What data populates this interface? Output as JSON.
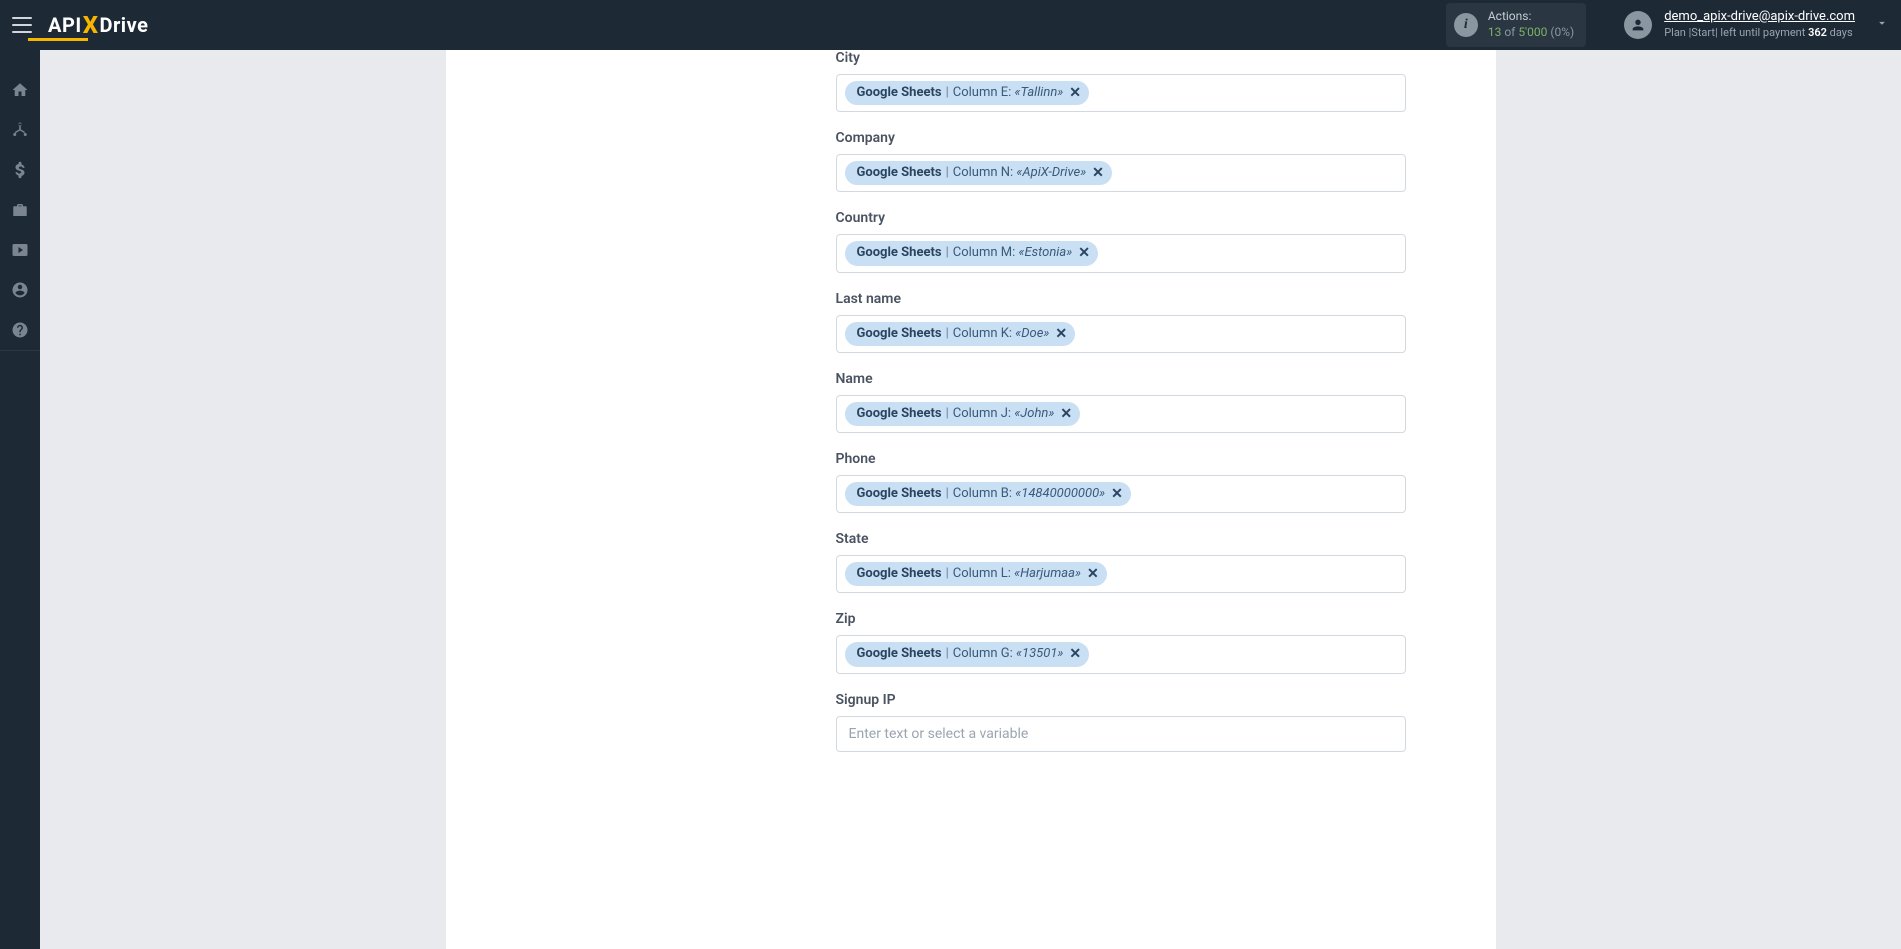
{
  "header": {
    "logo_prefix": "API",
    "logo_x": "X",
    "logo_suffix": "Drive",
    "actions_label": "Actions:",
    "actions_used": "13",
    "actions_of": "of",
    "actions_limit": "5'000",
    "actions_pct": "(0%)",
    "user_email": "demo_apix-drive@apix-drive.com",
    "plan_prefix": "Plan |",
    "plan_name": "Start",
    "plan_mid": "| left until payment ",
    "plan_days": "362",
    "plan_suffix": " days"
  },
  "fields": [
    {
      "label": "City",
      "source": "Google Sheets",
      "column": "Column E:",
      "value": "«Tallinn»"
    },
    {
      "label": "Company",
      "source": "Google Sheets",
      "column": "Column N:",
      "value": "«ApiX-Drive»"
    },
    {
      "label": "Country",
      "source": "Google Sheets",
      "column": "Column M:",
      "value": "«Estonia»"
    },
    {
      "label": "Last name",
      "source": "Google Sheets",
      "column": "Column K:",
      "value": "«Doe»"
    },
    {
      "label": "Name",
      "source": "Google Sheets",
      "column": "Column J:",
      "value": "«John»"
    },
    {
      "label": "Phone",
      "source": "Google Sheets",
      "column": "Column B:",
      "value": "«14840000000»"
    },
    {
      "label": "State",
      "source": "Google Sheets",
      "column": "Column L:",
      "value": "«Harjumaa»"
    },
    {
      "label": "Zip",
      "source": "Google Sheets",
      "column": "Column G:",
      "value": "«13501»"
    }
  ],
  "empty_field": {
    "label": "Signup IP",
    "placeholder": "Enter text or select a variable"
  }
}
